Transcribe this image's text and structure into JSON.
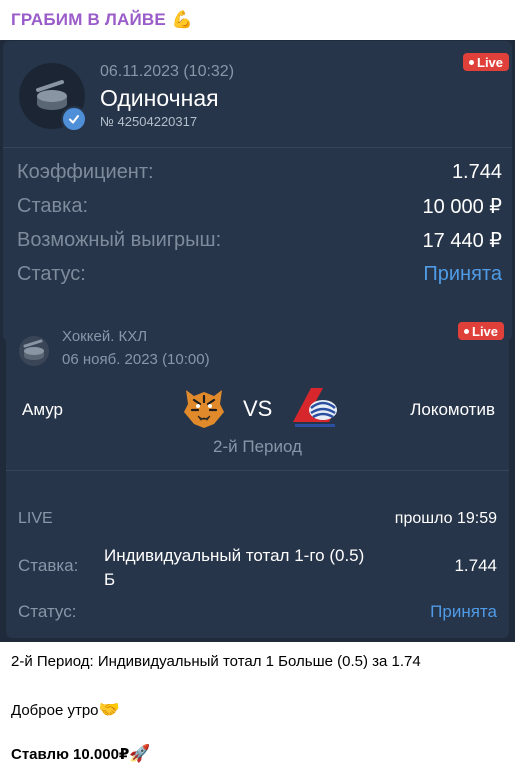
{
  "channel": {
    "title": "ГРАБИМ В ЛАЙВЕ",
    "title_emoji": "💪"
  },
  "coupon": {
    "date": "06.11.2023 (10:32)",
    "type": "Одиночная",
    "number": "№ 42504220317",
    "live_badge": "Live",
    "rows": [
      {
        "label": "Коэффициент:",
        "value": "1.744"
      },
      {
        "label": "Ставка:",
        "value": "10 000 ₽"
      },
      {
        "label": "Возможный выигрыш:",
        "value": "17 440 ₽"
      },
      {
        "label": "Статус:",
        "value": "Принята"
      }
    ]
  },
  "event": {
    "league": "Хоккей. КХЛ",
    "date": "06 нояб. 2023 (10:00)",
    "live_badge": "Live",
    "home_team": "Амур",
    "vs": "VS",
    "away_team": "Локомотив",
    "period": "2-й Период",
    "live_label": "LIVE",
    "elapsed": "прошло 19:59",
    "stake_label": "Ставка:",
    "stake_description": "Индивидуальный тотал 1-го (0.5) Б",
    "stake_odds": "1.744",
    "status_label": "Статус:",
    "status_value": "Принята"
  },
  "colors": {
    "accent": "#4f9be6",
    "live": "#e0403a",
    "channel_title": "#9a5cc9",
    "card_bg": "#27354a"
  },
  "message": {
    "line1": "2-й Период: Индивидуальный тотал 1 Больше (0.5) за 1.74",
    "line2": "Доброе утро",
    "line2_emoji": "🤝",
    "line3": "Ставлю 10.000₽",
    "line3_emoji": "🚀"
  }
}
